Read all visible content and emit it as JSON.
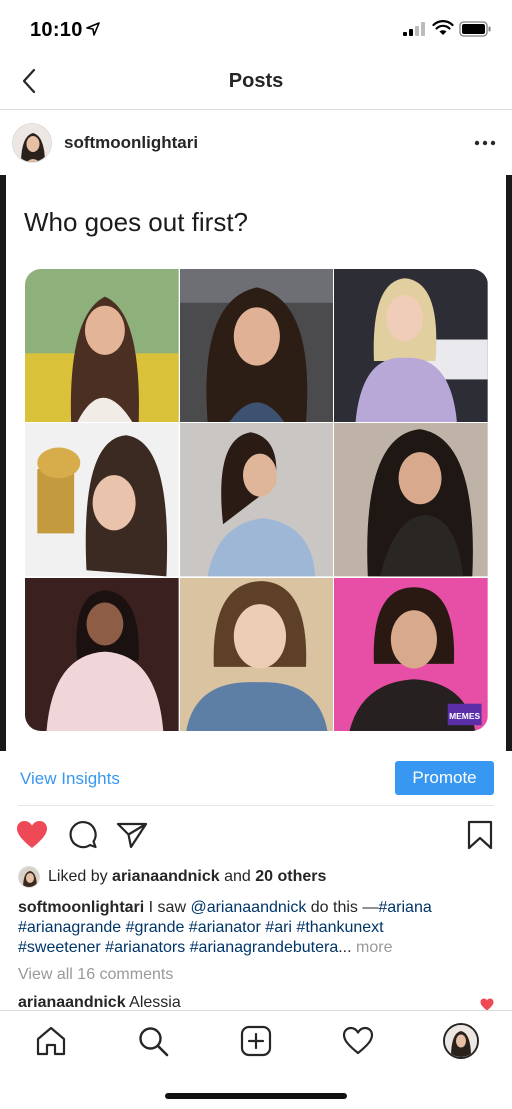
{
  "status_bar": {
    "time": "10:10"
  },
  "nav": {
    "title": "Posts"
  },
  "post": {
    "username": "softmoonlightari",
    "image_text": "Who goes out first?",
    "grid_logos": [
      "MEMES"
    ]
  },
  "actions": {
    "view_insights": "View Insights",
    "promote": "Promote",
    "liked_by_prefix": "Liked by ",
    "liked_by_user": "arianaandnick",
    "liked_by_suffix": " and ",
    "liked_by_others": "20 others"
  },
  "caption": {
    "username": "softmoonlightari",
    "text_before": " I saw ",
    "mention": "@arianaandnick",
    "text_after": " do this —",
    "tags_line1": "#ariana",
    "tags_line2": "#arianagrande #grande #arianator #ari #thankunext",
    "tags_line3": "#sweetener #arianators #arianagrandebutera",
    "ellipsis": "...",
    "more": " more"
  },
  "comments": {
    "view_all": "View all 16 comments",
    "first_user": "arianaandnick",
    "first_text": " Alessia"
  },
  "colors": {
    "accent": "#3897f0",
    "like": "#ed4956",
    "hashtag": "#003569"
  },
  "icons": [
    "back-chevron-icon",
    "more-icon",
    "heart-filled-icon",
    "comment-icon",
    "share-icon",
    "bookmark-icon",
    "home-icon",
    "search-icon",
    "add-post-icon",
    "activity-heart-icon",
    "profile-avatar"
  ]
}
